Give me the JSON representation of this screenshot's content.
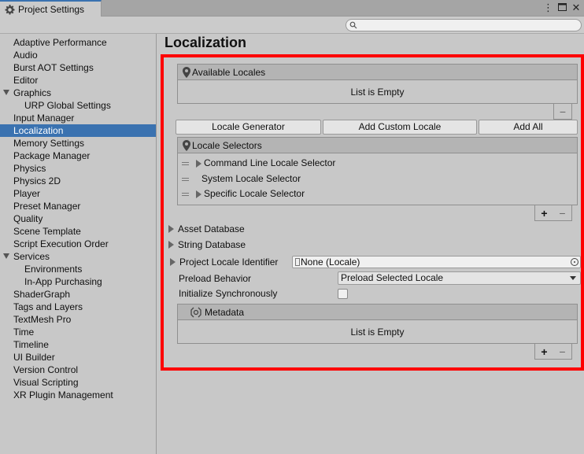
{
  "window": {
    "tab_title": "Project Settings",
    "tab_icon": "gear-icon",
    "buttons": [
      "menu-dots-icon",
      "maximize-icon",
      "close-icon"
    ]
  },
  "search": {
    "placeholder": ""
  },
  "sidebar": {
    "items": [
      {
        "label": "Adaptive Performance"
      },
      {
        "label": "Audio"
      },
      {
        "label": "Burst AOT Settings"
      },
      {
        "label": "Editor"
      },
      {
        "label": "Graphics",
        "expanded": true
      },
      {
        "label": "URP Global Settings",
        "sub": true
      },
      {
        "label": "Input Manager"
      },
      {
        "label": "Localization",
        "selected": true
      },
      {
        "label": "Memory Settings"
      },
      {
        "label": "Package Manager"
      },
      {
        "label": "Physics"
      },
      {
        "label": "Physics 2D"
      },
      {
        "label": "Player"
      },
      {
        "label": "Preset Manager"
      },
      {
        "label": "Quality"
      },
      {
        "label": "Scene Template"
      },
      {
        "label": "Script Execution Order"
      },
      {
        "label": "Services",
        "expanded": true
      },
      {
        "label": "Environments",
        "sub": true
      },
      {
        "label": "In-App Purchasing",
        "sub": true
      },
      {
        "label": "ShaderGraph"
      },
      {
        "label": "Tags and Layers"
      },
      {
        "label": "TextMesh Pro"
      },
      {
        "label": "Time"
      },
      {
        "label": "Timeline"
      },
      {
        "label": "UI Builder"
      },
      {
        "label": "Version Control"
      },
      {
        "label": "Visual Scripting"
      },
      {
        "label": "XR Plugin Management"
      }
    ]
  },
  "main": {
    "title": "Localization",
    "available_locales": {
      "header": "Available Locales",
      "empty": "List is Empty",
      "minus": "−"
    },
    "buttons": {
      "locale_generator": "Locale Generator",
      "add_custom_locale": "Add Custom Locale",
      "add_all": "Add All"
    },
    "locale_selectors": {
      "header": "Locale Selectors",
      "items": [
        {
          "label": "Command Line Locale Selector",
          "foldout": true
        },
        {
          "label": "System Locale Selector",
          "foldout": false
        },
        {
          "label": "Specific Locale Selector",
          "foldout": true
        }
      ],
      "plus": "+",
      "minus": "−"
    },
    "asset_database": "Asset Database",
    "string_database": "String Database",
    "project_locale_identifier": {
      "label": "Project Locale Identifier",
      "value": "None (Locale)"
    },
    "preload_behavior": {
      "label": "Preload Behavior",
      "value": "Preload Selected Locale"
    },
    "initialize_synchronously": {
      "label": "Initialize Synchronously",
      "checked": false
    },
    "metadata": {
      "header": "Metadata",
      "empty": "List is Empty",
      "plus": "+",
      "minus": "−"
    }
  },
  "colors": {
    "selection": "#3a72b0",
    "highlight_border": "#ff0000"
  }
}
